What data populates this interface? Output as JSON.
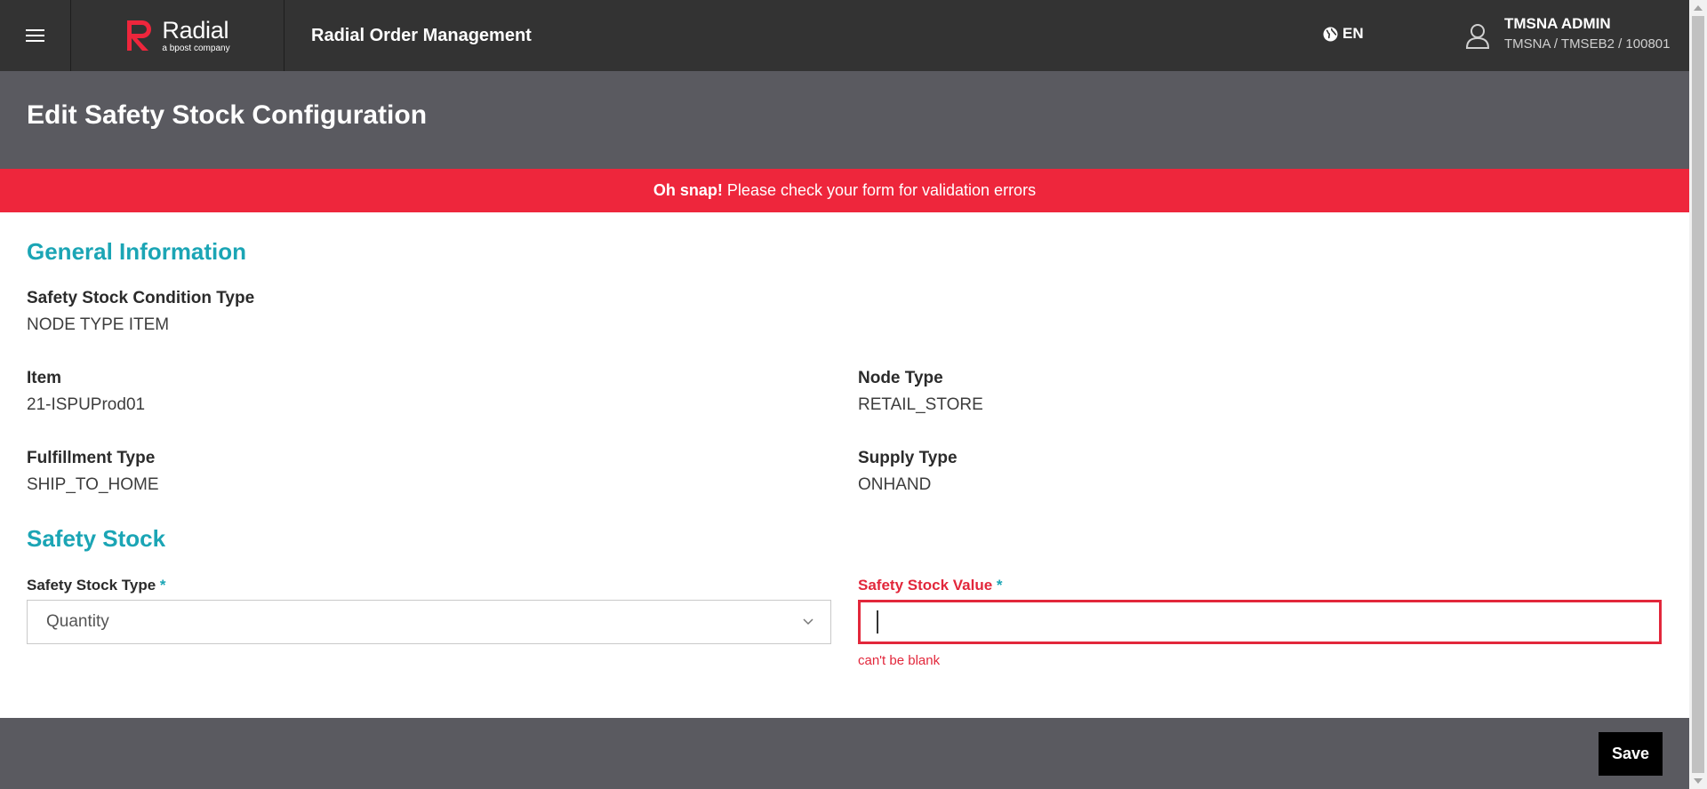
{
  "topbar": {
    "menu_icon": "hamburger-menu-icon",
    "logo_name": "Radial",
    "logo_tagline": "a bpost company",
    "app_title": "Radial Order Management",
    "language": "EN",
    "user_name": "TMSNA ADMIN",
    "user_org": "TMSNA / TMSEB2 / 100801"
  },
  "page": {
    "title": "Edit Safety Stock Configuration"
  },
  "alert": {
    "strong": "Oh snap!",
    "message": "Please check your form for validation errors"
  },
  "general": {
    "section_title": "General Information",
    "condition_type_label": "Safety Stock Condition Type",
    "condition_type_value": "NODE TYPE ITEM",
    "item_label": "Item",
    "item_value": "21-ISPUProd01",
    "node_type_label": "Node Type",
    "node_type_value": "RETAIL_STORE",
    "fulfillment_type_label": "Fulfillment Type",
    "fulfillment_type_value": "SHIP_TO_HOME",
    "supply_type_label": "Supply Type",
    "supply_type_value": "ONHAND"
  },
  "safety_stock": {
    "section_title": "Safety Stock",
    "type_label": "Safety Stock Type",
    "type_value": "Quantity",
    "value_label": "Safety Stock Value",
    "value_input": "",
    "required_mark": "*",
    "error_message": "can't be blank"
  },
  "footer": {
    "save_label": "Save"
  },
  "colors": {
    "topbar": "#333333",
    "header": "#5a5a60",
    "alert": "#ee263c",
    "accent": "#1ba5b5",
    "error": "#e2273b"
  }
}
